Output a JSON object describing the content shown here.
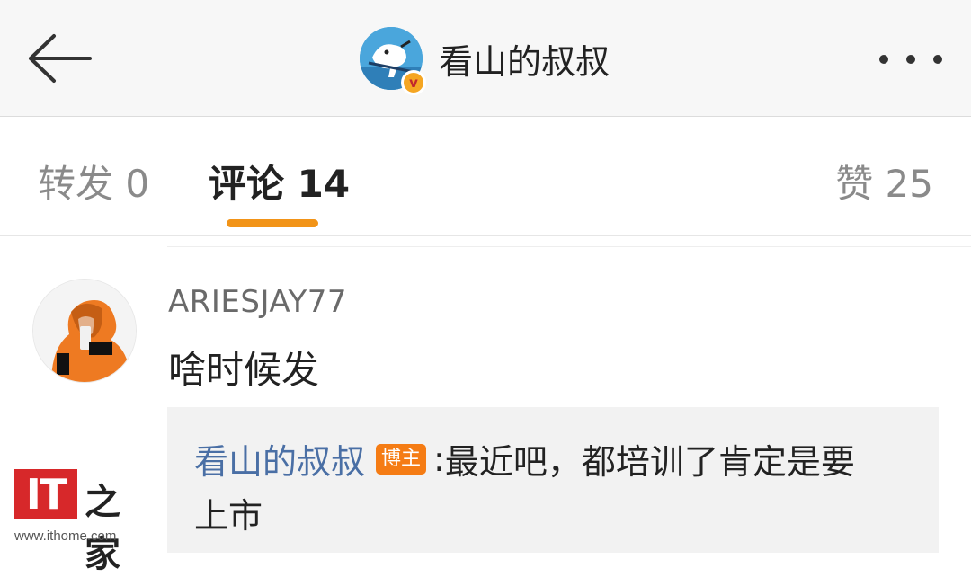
{
  "header": {
    "title": "看山的叔叔",
    "verified_badge": "v",
    "back_icon": "arrow-left-icon",
    "more_icon": "more-dots-icon"
  },
  "tabs": {
    "repost": "转发 0",
    "comment": "评论 14",
    "like": "赞 25",
    "active": "comment",
    "accent_color": "#f29418"
  },
  "comment": {
    "username": "ARIESJAY77",
    "text": "啥时候发",
    "reply": {
      "author": "看山的叔叔",
      "badge": "博主",
      "colon": ":",
      "line1": "最近吧，都培训了肯定是要",
      "line2": "上市"
    }
  },
  "watermark": {
    "logo": "IT",
    "chinese": "之家",
    "url": "www.ithome.com"
  }
}
